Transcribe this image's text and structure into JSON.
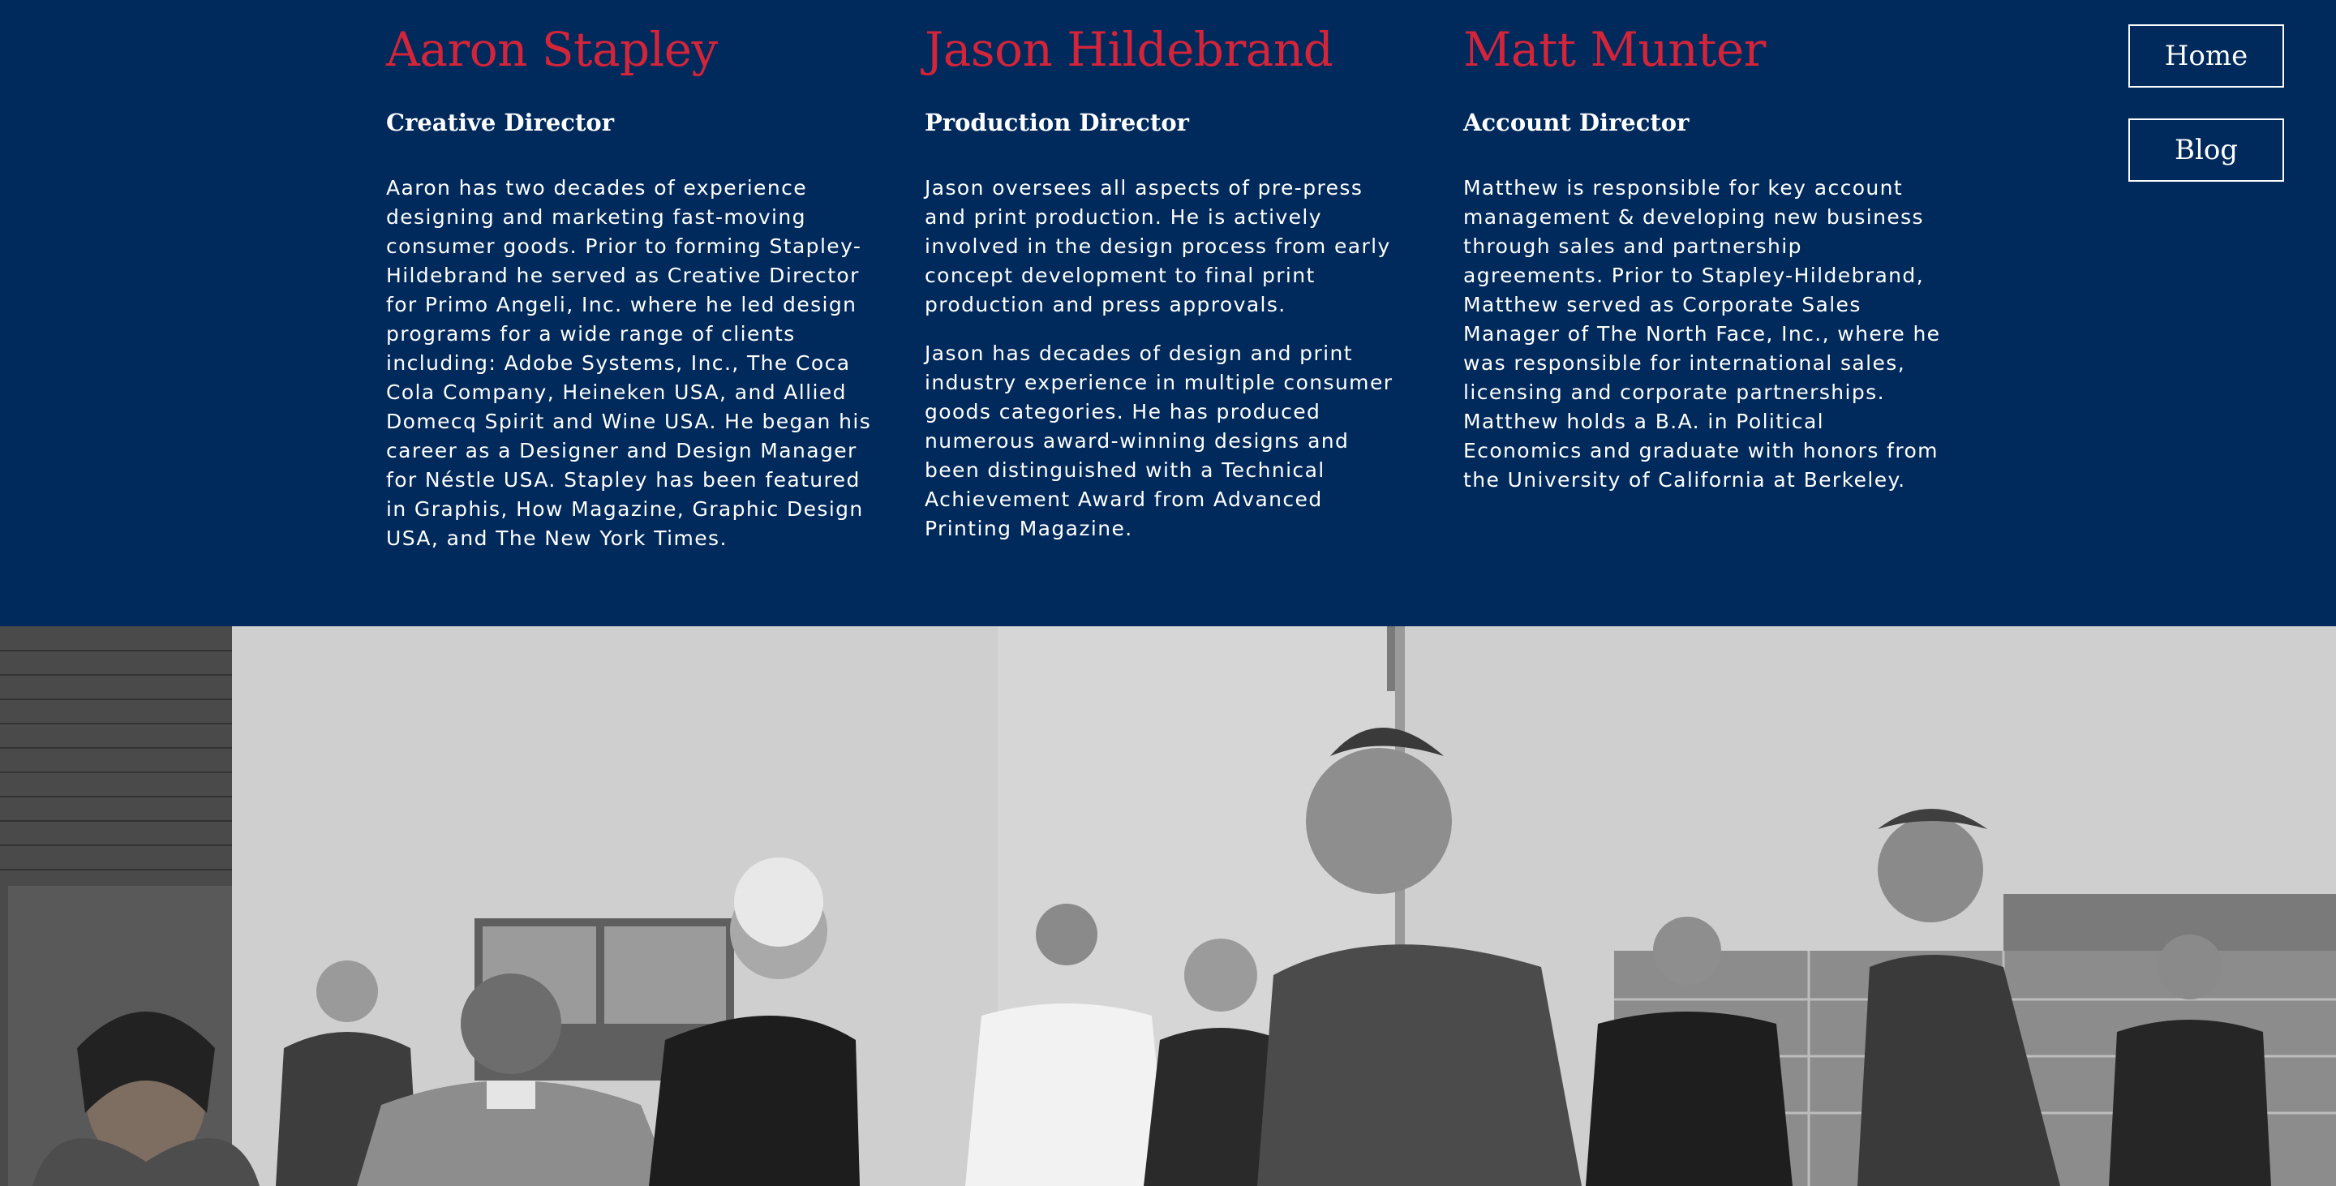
{
  "nav": {
    "home_label": "Home",
    "blog_label": "Blog"
  },
  "team": [
    {
      "name": "Aaron Stapley",
      "role": "Creative Director",
      "paragraphs": [
        "Aaron has two decades of experience designing and marketing fast-moving consumer goods. Prior to forming Stapley-Hildebrand he served as Creative Director for Primo Angeli, Inc. where he led design programs for a wide range of clients including: Adobe Systems, Inc., The Coca Cola Company, Heineken USA, and Allied Domecq Spirit and Wine USA. He began his career as a Designer and Design Manager for Néstle USA. Stapley has been featured in Graphis, How Magazine, Graphic Design USA, and The New York Times."
      ]
    },
    {
      "name": "Jason Hildebrand",
      "role": "Production Director",
      "paragraphs": [
        "Jason oversees all aspects of pre-press and print production. He is actively involved in the design process from early concept development to final print production and press approvals.",
        "Jason has decades of design and print industry experience in multiple consumer goods categories. He has produced numerous award-winning designs and been distinguished with a Technical Achievement Award from Advanced Printing Magazine."
      ]
    },
    {
      "name": "Matt Munter",
      "role": "Account Director",
      "paragraphs": [
        "Matthew is responsible for key account management & developing new business through sales and partnership agreements. Prior to Stapley-Hildebrand, Matthew served as Corporate Sales Manager of The North Face, Inc., where he was responsible for international sales, licensing and corporate partnerships. Matthew holds a B.A. in Political Economics and graduate with honors from the University of California at Berkeley."
      ]
    }
  ],
  "colors": {
    "background": "#002a5c",
    "name_accent": "#d3243a",
    "text": "#ffffff"
  }
}
